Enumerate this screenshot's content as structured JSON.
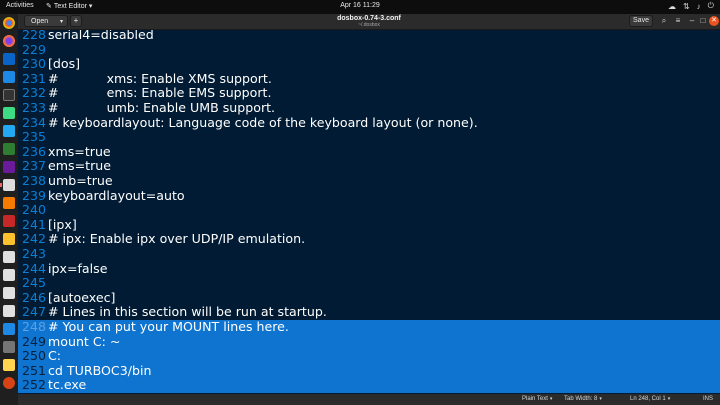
{
  "topbar": {
    "activities": "Activities",
    "app_name": "Text Editor",
    "clock": "Apr 16  11:29",
    "tray_icons": [
      "cloud-icon",
      "network-icon",
      "volume-icon",
      "power-icon"
    ]
  },
  "dock": {
    "apps": [
      "chrome-icon",
      "firefox-icon",
      "outlook-icon",
      "windows-app-icon",
      "terminal-icon",
      "android-icon",
      "vscode-icon",
      "text-editor-icon",
      "vlc-icon",
      "app-icon",
      "app-icon",
      "app-icon",
      "app-icon",
      "app-icon",
      "app-icon",
      "app-icon",
      "app-icon",
      "app-icon",
      "app-icon",
      "app-icon"
    ]
  },
  "header": {
    "open_label": "Open",
    "new_tab": "+",
    "title": "dosbox-0.74-3.conf",
    "path": "~/.dosbox",
    "save_label": "Save",
    "search_icon": "⌕",
    "menu_icon": "≡",
    "minimize_icon": "–",
    "maximize_icon": "□",
    "close_icon": "✕"
  },
  "editor": {
    "lines": [
      {
        "n": "228",
        "text": "serial4=disabled"
      },
      {
        "n": "229",
        "text": ""
      },
      {
        "n": "230",
        "text": "[dos]"
      },
      {
        "n": "231",
        "text": "#            xms: Enable XMS support."
      },
      {
        "n": "232",
        "text": "#            ems: Enable EMS support."
      },
      {
        "n": "233",
        "text": "#            umb: Enable UMB support."
      },
      {
        "n": "234",
        "text": "# keyboardlayout: Language code of the keyboard layout (or none)."
      },
      {
        "n": "235",
        "text": ""
      },
      {
        "n": "236",
        "text": "xms=true"
      },
      {
        "n": "237",
        "text": "ems=true"
      },
      {
        "n": "238",
        "text": "umb=true"
      },
      {
        "n": "239",
        "text": "keyboardlayout=auto"
      },
      {
        "n": "240",
        "text": ""
      },
      {
        "n": "241",
        "text": "[ipx]"
      },
      {
        "n": "242",
        "text": "# ipx: Enable ipx over UDP/IP emulation."
      },
      {
        "n": "243",
        "text": ""
      },
      {
        "n": "244",
        "text": "ipx=false"
      },
      {
        "n": "245",
        "text": ""
      },
      {
        "n": "246",
        "text": "[autoexec]"
      },
      {
        "n": "247",
        "text": "# Lines in this section will be run at startup."
      },
      {
        "n": "248",
        "text": "# You can put your MOUNT lines here."
      },
      {
        "n": "249",
        "text": "mount C: ~"
      },
      {
        "n": "250",
        "text": "C:"
      },
      {
        "n": "251",
        "text": "cd TURBOC3/bin"
      },
      {
        "n": "252",
        "text": "tc.exe"
      }
    ],
    "selected_from": 20,
    "current_line": 20
  },
  "status": {
    "language": "Plain Text",
    "tab_width": "Tab Width: 8",
    "position": "Ln 248, Col 1",
    "mode": "INS"
  },
  "colors": {
    "editor_bg": "#001b33",
    "selection": "#0e74d0",
    "line_number": "#0a7fd6",
    "close_button": "#e95420"
  }
}
